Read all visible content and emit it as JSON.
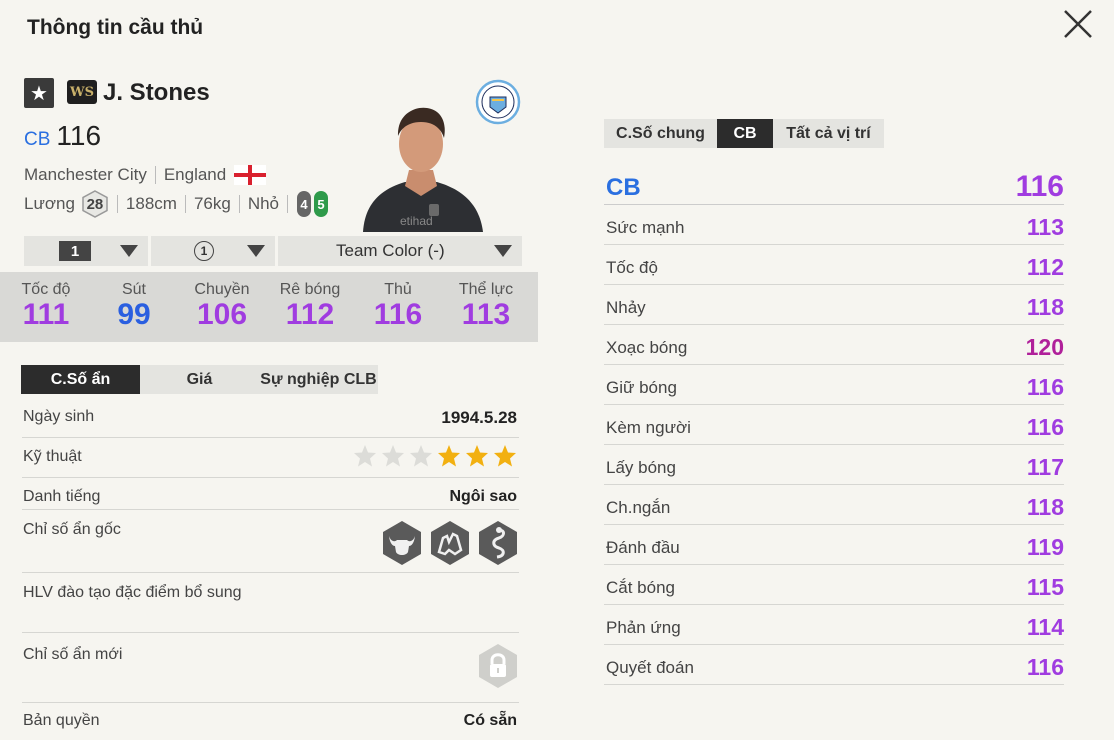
{
  "title": "Thông tin cầu thủ",
  "player": {
    "season_badge": "WS",
    "name": "J. Stones",
    "position": "CB",
    "ovr": "116",
    "club": "Manchester City",
    "nation": "England",
    "salary_label": "Lương",
    "salary": "28",
    "height": "188cm",
    "weight": "76kg",
    "body": "Nhỏ",
    "weak_foot": "4",
    "strong_foot": "5"
  },
  "controls": {
    "level": "1",
    "team_ovr": "1",
    "team_color": "Team Color (-)"
  },
  "main_stats": [
    {
      "label": "Tốc độ",
      "value": "111",
      "color": "#a03ce0"
    },
    {
      "label": "Sút",
      "value": "99",
      "color": "#2a5fe0"
    },
    {
      "label": "Chuyền",
      "value": "106",
      "color": "#a03ce0"
    },
    {
      "label": "Rê bóng",
      "value": "112",
      "color": "#a03ce0"
    },
    {
      "label": "Thủ",
      "value": "116",
      "color": "#a03ce0"
    },
    {
      "label": "Thể lực",
      "value": "113",
      "color": "#a03ce0"
    }
  ],
  "left_tabs": [
    "C.Số ẩn",
    "Giá",
    "Sự nghiệp CLB"
  ],
  "details": {
    "birth_label": "Ngày sinh",
    "birth": "1994.5.28",
    "skill_label": "Kỹ thuật",
    "skill_stars": 3,
    "skill_max": 6,
    "fame_label": "Danh tiếng",
    "fame": "Ngôi sao",
    "traits_label": "Chỉ số ẩn gốc",
    "coach_label": "HLV đào tạo đặc điểm bổ sung",
    "new_traits_label": "Chỉ số ẩn mới",
    "license_label": "Bản quyền",
    "license": "Có sẵn"
  },
  "trait_icons": [
    "bull-icon",
    "hands-icon",
    "snake-icon"
  ],
  "right_tabs": [
    "C.Số chung",
    "CB",
    "Tất cả vị trí"
  ],
  "position_stats": {
    "position": "CB",
    "ovr": "116",
    "rows": [
      {
        "label": "Sức mạnh",
        "value": "113",
        "color": "#a03ce0"
      },
      {
        "label": "Tốc độ",
        "value": "112",
        "color": "#a03ce0"
      },
      {
        "label": "Nhảy",
        "value": "118",
        "color": "#a03ce0"
      },
      {
        "label": "Xoạc bóng",
        "value": "120",
        "color": "#b0209a"
      },
      {
        "label": "Giữ bóng",
        "value": "116",
        "color": "#a03ce0"
      },
      {
        "label": "Kèm người",
        "value": "116",
        "color": "#a03ce0"
      },
      {
        "label": "Lấy bóng",
        "value": "117",
        "color": "#a03ce0"
      },
      {
        "label": "Ch.ngắn",
        "value": "118",
        "color": "#a03ce0"
      },
      {
        "label": "Đánh đầu",
        "value": "119",
        "color": "#a03ce0"
      },
      {
        "label": "Cắt bóng",
        "value": "115",
        "color": "#a03ce0"
      },
      {
        "label": "Phản ứng",
        "value": "114",
        "color": "#a03ce0"
      },
      {
        "label": "Quyết đoán",
        "value": "116",
        "color": "#a03ce0"
      }
    ]
  }
}
